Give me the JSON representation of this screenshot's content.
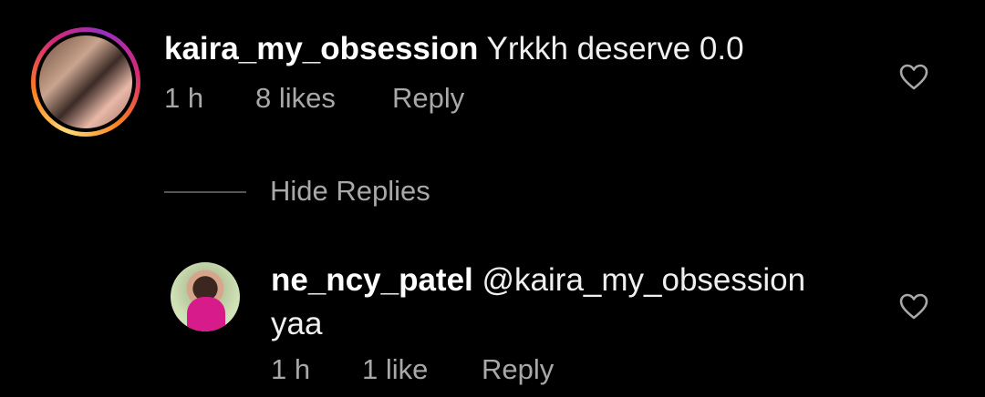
{
  "comments": [
    {
      "username": "kaira_my_obsession",
      "text": "Yrkkh deserve 0.0",
      "time": "1 h",
      "likes": "8 likes",
      "reply_label": "Reply",
      "avatar_ring": true,
      "like_icon": "heart-outline-icon"
    }
  ],
  "hide_replies_label": "Hide Replies",
  "replies": [
    {
      "username": "ne_ncy_patel",
      "mention": "@kaira_my_obsession",
      "text": "yaa",
      "time": "1 h",
      "likes": "1 like",
      "reply_label": "Reply",
      "like_icon": "heart-outline-icon"
    }
  ],
  "colors": {
    "background": "#000000",
    "primary_text": "#ffffff",
    "secondary_text": "#a8a8a8",
    "story_ring": [
      "#feda75",
      "#fa7e1e",
      "#d62976",
      "#962fbf"
    ]
  }
}
